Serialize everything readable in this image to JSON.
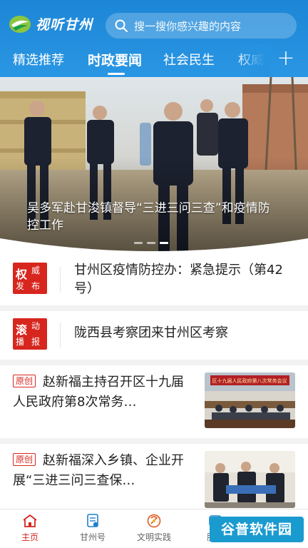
{
  "header": {
    "app_name": "视听甘州",
    "search_placeholder": "搜一搜你感兴趣的内容",
    "accent_color": "#1d86d6"
  },
  "tabs": [
    {
      "label": "精选推荐",
      "active": false
    },
    {
      "label": "时政要闻",
      "active": true
    },
    {
      "label": "社会民生",
      "active": false
    },
    {
      "label": "权威",
      "active": false
    }
  ],
  "tab_add_label": "+",
  "hero": {
    "caption": "吴多军赴甘浚镇督导“三进三问三查”和疫情防控工作",
    "page_count": 3,
    "active_index": 2
  },
  "notices": [
    {
      "badge_big": "权",
      "badge_small_1": "威",
      "badge_small_2": "发",
      "badge_small_3": "布",
      "text": "甘州区疫情防控办：紧急提示（第42号）"
    },
    {
      "badge_big": "滚",
      "badge_small_1": "动",
      "badge_small_2": "播",
      "badge_small_3": "报",
      "text": "陇西县考察团来甘州区考察"
    }
  ],
  "news": [
    {
      "tag": "原创",
      "title": "赵新福主持召开区十九届人民政府第8次常务…"
    },
    {
      "tag": "原创",
      "title": "赵新福深入乡镇、企业开展“三进三问三查保…"
    }
  ],
  "news_thumb_banner": "区十九届人民政府第八次常务会议",
  "bottom_nav": [
    {
      "label": "主页",
      "icon": "home-icon",
      "active": true
    },
    {
      "label": "甘州号",
      "icon": "document-icon",
      "active": false
    },
    {
      "label": "文明实践",
      "icon": "emblem-icon",
      "active": false
    },
    {
      "label": "服务",
      "icon": "service-icon",
      "active": false
    }
  ],
  "watermark": "谷普软件园",
  "colors": {
    "red": "#d7261e",
    "header_blue": "#1d86d6"
  }
}
